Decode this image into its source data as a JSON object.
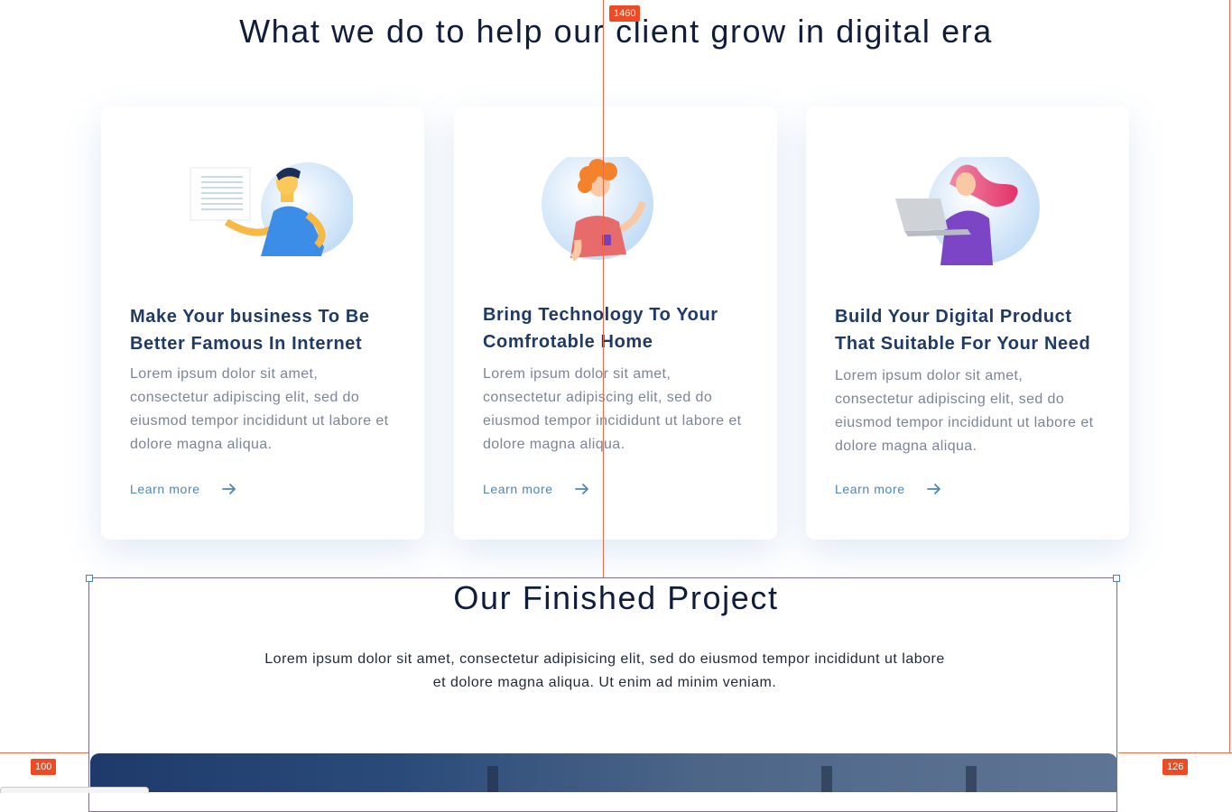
{
  "services": {
    "heading": "What we do to help our client grow in digital era",
    "cards": [
      {
        "title": "Make Your business To Be Better Famous In Internet",
        "text": "Lorem ipsum dolor sit amet, consectetur adipiscing elit, sed do eiusmod tempor incididunt ut labore et dolore magna aliqua.",
        "link": "Learn more"
      },
      {
        "title": "Bring Technology To Your Comfrotable Home",
        "text": "Lorem ipsum dolor sit amet, consectetur adipiscing elit, sed do eiusmod tempor incididunt ut labore et dolore magna aliqua.",
        "link": "Learn more"
      },
      {
        "title": "Build Your Digital Product That Suitable For Your Need",
        "text": "Lorem ipsum dolor sit amet, consectetur adipiscing elit, sed do eiusmod tempor incididunt ut labore et dolore magna aliqua.",
        "link": "Learn more"
      }
    ]
  },
  "projects": {
    "heading": "Our Finished Project",
    "text": "Lorem ipsum dolor sit amet, consectetur adipisicing elit, sed do eiusmod tempor incididunt ut labore et dolore magna aliqua. Ut enim ad minim veniam."
  },
  "measure": {
    "vertical": "1460",
    "left_gap": "100",
    "right_gap": "126"
  },
  "colors": {
    "guide": "#ec6a4a",
    "badge": "#ee4a23",
    "heading": "#0f1d3a",
    "card_title": "#1f3a64",
    "link": "#4f86b8"
  }
}
